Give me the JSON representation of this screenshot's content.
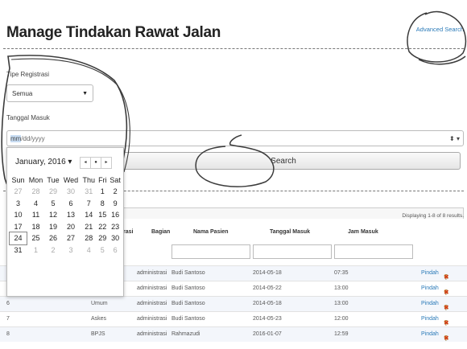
{
  "page": {
    "title": "Manage Tindakan Rawat Jalan",
    "advanced_search": "Advanced Search"
  },
  "form": {
    "tipe_label": "Tipe Registrasi",
    "tipe_value": "Semua",
    "tanggal_label": "Tanggal Masuk",
    "date_selected": "mm",
    "date_rest": "/dd/yyyy",
    "search_label": "Search"
  },
  "calendar": {
    "month": "January, 2016",
    "month_caret": "▾",
    "nav": [
      "◂",
      "●",
      "▸"
    ],
    "weekdays": [
      "Sun",
      "Mon",
      "Tue",
      "Wed",
      "Thu",
      "Fri",
      "Sat"
    ],
    "weeks": [
      [
        "27",
        "28",
        "29",
        "30",
        "31",
        "1",
        "2"
      ],
      [
        "3",
        "4",
        "5",
        "6",
        "7",
        "8",
        "9"
      ],
      [
        "10",
        "11",
        "12",
        "13",
        "14",
        "15",
        "16"
      ],
      [
        "17",
        "18",
        "19",
        "20",
        "21",
        "22",
        "23"
      ],
      [
        "24",
        "25",
        "26",
        "27",
        "28",
        "29",
        "30"
      ],
      [
        "31",
        "1",
        "2",
        "3",
        "4",
        "5",
        "6"
      ]
    ]
  },
  "table": {
    "summary": "Displaying 1-8 of 8 results.",
    "headers": {
      "tipe": "rasi",
      "bagian": "Bagian",
      "nama": "Nama Pasien",
      "tanggal": "Tanggal Masuk",
      "jam": "Jam Masuk"
    },
    "rows": [
      {
        "no": "",
        "tipe": "",
        "bagian": "administrasi",
        "nama": "Budi Santoso",
        "tanggal": "2014-05-18",
        "jam": "07:35",
        "aksi": "Pindah"
      },
      {
        "no": "",
        "tipe": "",
        "bagian": "administrasi",
        "nama": "Budi Santoso",
        "tanggal": "2014-05-22",
        "jam": "13:00",
        "aksi": "Pindah"
      },
      {
        "no": "6",
        "tipe": "Umum",
        "bagian": "administrasi",
        "nama": "Budi Santoso",
        "tanggal": "2014-05-18",
        "jam": "13:00",
        "aksi": "Pindah"
      },
      {
        "no": "7",
        "tipe": "Askes",
        "bagian": "administrasi",
        "nama": "Budi Santoso",
        "tanggal": "2014-05-23",
        "jam": "12:00",
        "aksi": "Pindah"
      },
      {
        "no": "8",
        "tipe": "BPJS",
        "bagian": "administrasi",
        "nama": "Rahmazudi",
        "tanggal": "2016-01-07",
        "jam": "12:59",
        "aksi": "Pindah"
      }
    ]
  }
}
